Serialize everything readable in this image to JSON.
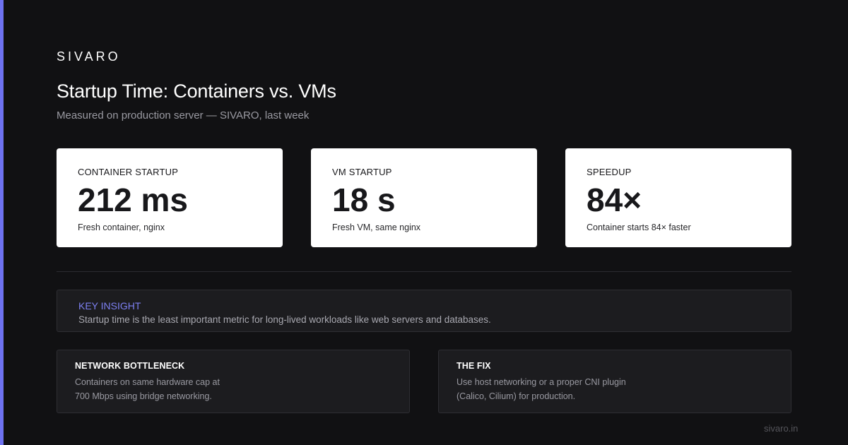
{
  "brand": "SIVARO",
  "title": "Startup Time: Containers vs. VMs",
  "subtitle": "Measured on production server — SIVARO, last week",
  "colors": {
    "background": "#111113",
    "accent": "#6e72f0",
    "card": "#ffffff",
    "panel": "#1c1c1f",
    "insight_label": "#7d80f2"
  },
  "stats": [
    {
      "label": "CONTAINER STARTUP",
      "value": "212 ms",
      "note": "Fresh container, nginx"
    },
    {
      "label": "VM STARTUP",
      "value": "18 s",
      "note": "Fresh VM, same nginx"
    },
    {
      "label": "SPEEDUP",
      "value": "84×",
      "note": "Container starts 84× faster"
    }
  ],
  "insight": {
    "label": "KEY INSIGHT",
    "text": "Startup time is the least important metric for long-lived workloads like web servers and databases."
  },
  "panels": [
    {
      "title": "NETWORK BOTTLENECK",
      "lines": [
        "Containers on same hardware cap at",
        "700 Mbps using bridge networking."
      ]
    },
    {
      "title": "THE FIX",
      "lines": [
        "Use host networking or a proper CNI plugin",
        "(Calico, Cilium) for production."
      ]
    }
  ],
  "footer": {
    "url": "sivaro.in"
  }
}
